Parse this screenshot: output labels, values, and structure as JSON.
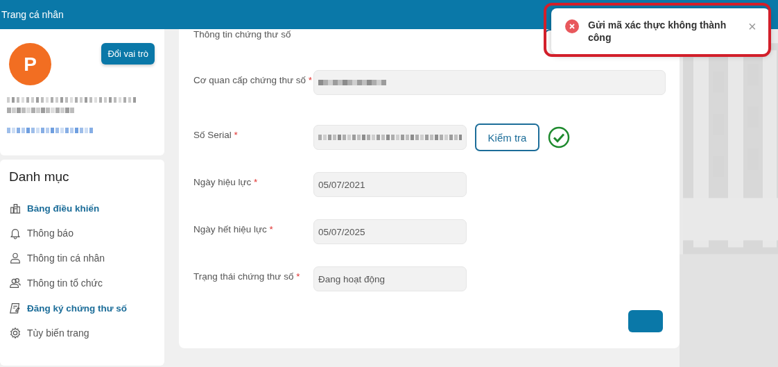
{
  "header": {
    "title": "Trang cá nhân"
  },
  "profile": {
    "avatar_letter": "P",
    "role_button": "Đổi vai trò"
  },
  "menu": {
    "title": "Danh mục",
    "items": [
      {
        "label": "Bảng điều khiển",
        "active": true
      },
      {
        "label": "Thông báo",
        "active": false
      },
      {
        "label": "Thông tin cá nhân",
        "active": false
      },
      {
        "label": "Thông tin tổ chức",
        "active": false
      },
      {
        "label": "Đăng ký chứng thư số",
        "active": true
      },
      {
        "label": "Tùy biến trang",
        "active": false
      }
    ]
  },
  "form": {
    "title": "Thông tin chứng thư số",
    "fields": [
      {
        "kind": "wide",
        "label": "Cơ quan cấp chứng thư số",
        "required_mark": "*",
        "redacted": true
      },
      {
        "kind": "serial",
        "label": "Số Serial",
        "required_mark": "*",
        "redacted": true,
        "check_button": "Kiểm tra",
        "verified": true
      },
      {
        "kind": "short",
        "label": "Ngày hiệu lực",
        "required_mark": "*",
        "value": "05/07/2021"
      },
      {
        "kind": "short",
        "label": "Ngày hết hiệu lực",
        "required_mark": "*",
        "value": "05/07/2025"
      },
      {
        "kind": "short",
        "label": "Trạng thái chứng thư số",
        "required_mark": "*",
        "value": "Đang hoạt động"
      }
    ]
  },
  "toast": {
    "message": "Gửi mã xác thực không thành công",
    "close": "×",
    "highlighted": true
  }
}
